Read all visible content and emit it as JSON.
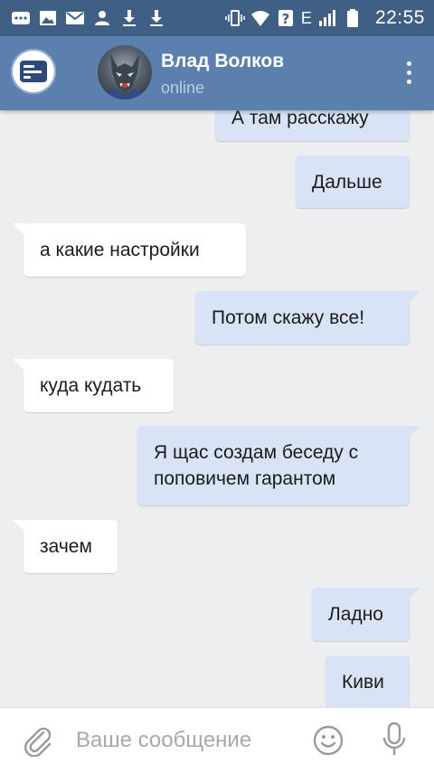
{
  "status_bar": {
    "time": "22:55",
    "network_label": "E",
    "left_icons": [
      "message-notification-icon",
      "image-notification-icon",
      "mail-notification-icon",
      "account-notification-icon",
      "download-icon",
      "download-icon"
    ],
    "right_icons": [
      "vibrate-icon",
      "wifi-icon",
      "signal-icon",
      "battery-icon"
    ]
  },
  "header": {
    "contact_name": "Влад Волков",
    "contact_status": "online"
  },
  "messages": [
    {
      "direction": "out",
      "text": "А там расскажу"
    },
    {
      "direction": "out",
      "text": "Дальше"
    },
    {
      "direction": "in",
      "text": "а какие настройки"
    },
    {
      "direction": "out",
      "text": "Потом скажу все!"
    },
    {
      "direction": "in",
      "text": "куда кудать"
    },
    {
      "direction": "out",
      "text": "Я щас создам беседу с поповичем гарантом"
    },
    {
      "direction": "in",
      "text": "зачем"
    },
    {
      "direction": "out",
      "text": "Ладно"
    },
    {
      "direction": "out",
      "text": "Киви"
    }
  ],
  "composer": {
    "placeholder": "Ваше сообщение"
  },
  "colors": {
    "status_bar": "#3f5f84",
    "app_bar": "#5b80ad",
    "chat_background": "#edeef0",
    "outgoing_bubble": "#d8e4f6",
    "incoming_bubble": "#ffffff"
  }
}
